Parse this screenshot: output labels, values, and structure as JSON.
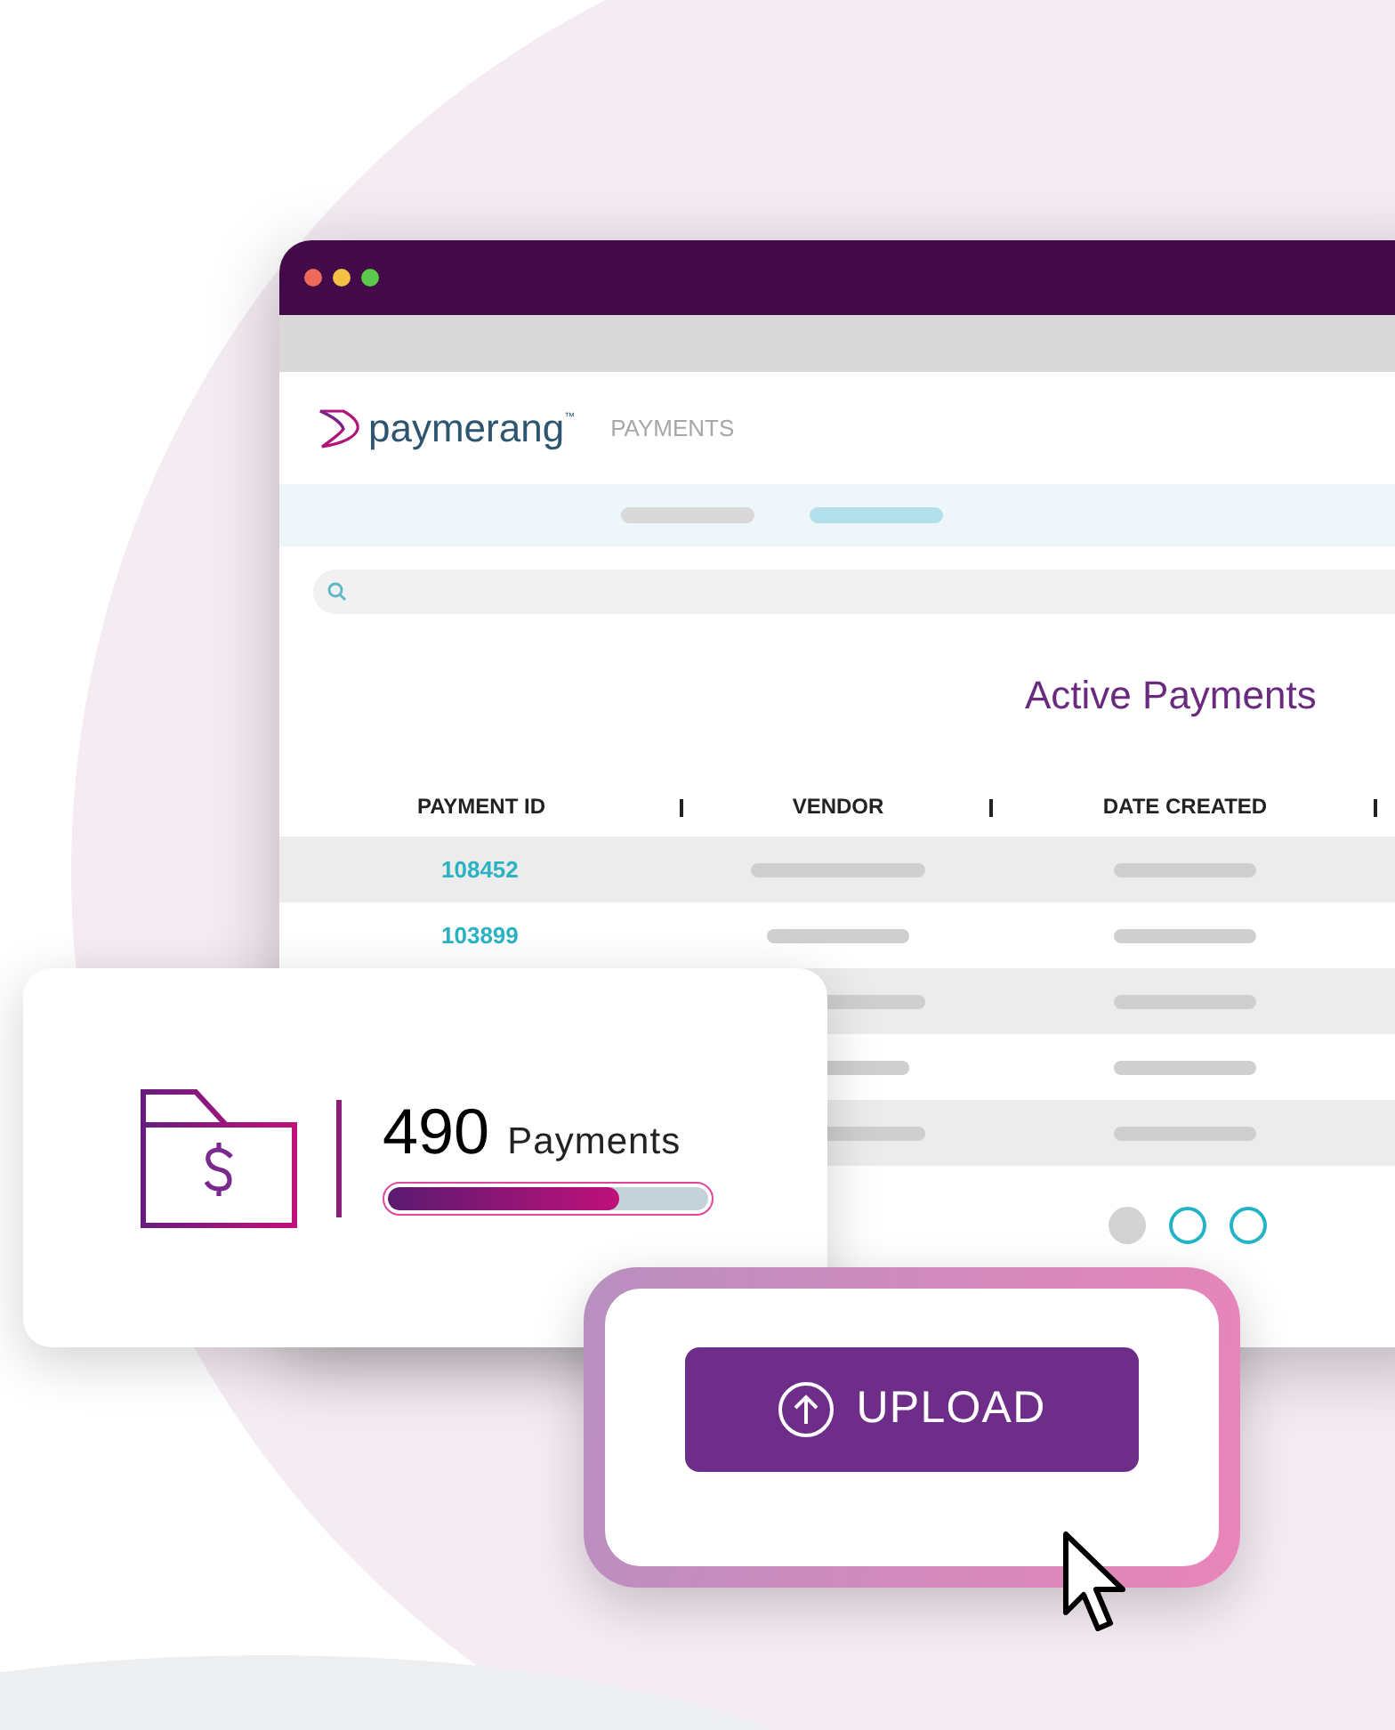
{
  "app_window": {
    "logo": {
      "wordmark": "paymerang",
      "trademark": "™"
    },
    "nav_item": "PAYMENTS",
    "tabs": [
      {
        "selected": false
      },
      {
        "selected": true
      }
    ],
    "title": "Active Payments",
    "table": {
      "columns": [
        "PAYMENT ID",
        "VENDOR",
        "DATE CREATED"
      ],
      "rows": [
        {
          "payment_id": "108452"
        },
        {
          "payment_id": "103899"
        },
        {},
        {},
        {}
      ]
    },
    "pagination": [
      {
        "selected": true
      },
      {
        "selected": false
      },
      {
        "selected": false
      }
    ]
  },
  "stat_card": {
    "count": "490",
    "label": "Payments",
    "level": 0.72
  },
  "upload_button": {
    "label": "UPLOAD"
  }
}
